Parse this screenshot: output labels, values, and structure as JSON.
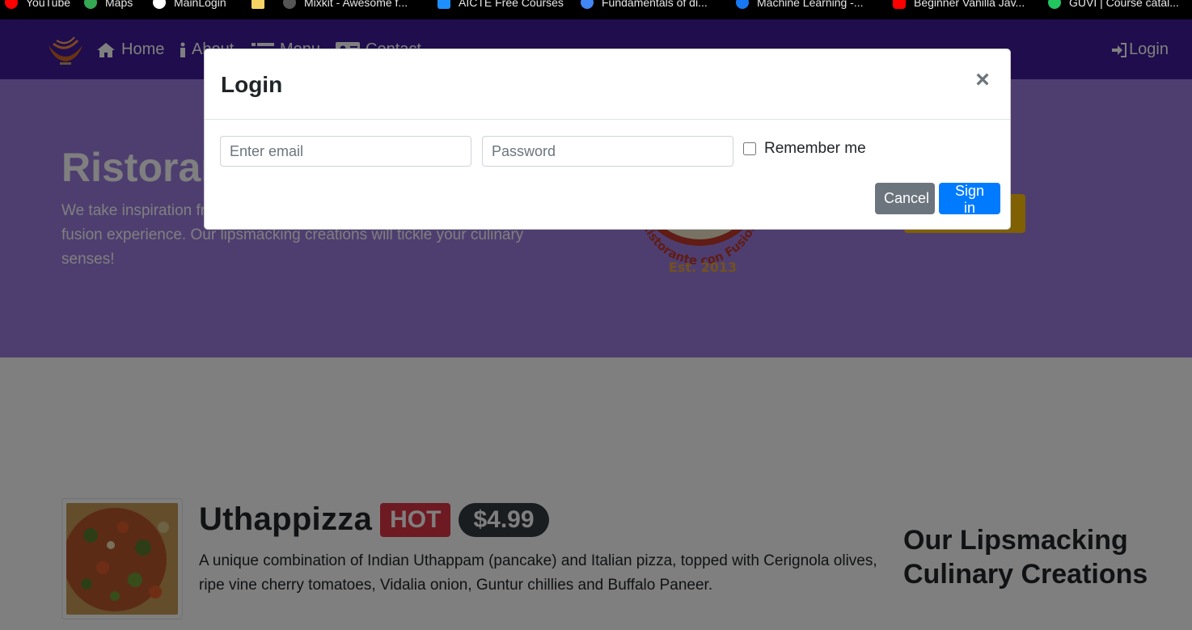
{
  "bookmarks": [
    {
      "label": "YouTube",
      "icon": "youtube-icon",
      "color": "#ff0000"
    },
    {
      "label": "Maps",
      "icon": "maps-icon",
      "color": "#34a853"
    },
    {
      "label": "MainLogin",
      "icon": "mainlogin-icon",
      "color": "#ffffff"
    },
    {
      "label": "",
      "icon": "folder-icon",
      "color": "#f6d365"
    },
    {
      "label": "Mixkit - Awesome f...",
      "icon": "mixkit-icon",
      "color": "#555555"
    },
    {
      "label": "AICTE Free Courses",
      "icon": "aicte-icon",
      "color": "#1f8fff"
    },
    {
      "label": "Fundamentals of di...",
      "icon": "google-icon",
      "color": "#4285f4"
    },
    {
      "label": "Machine Learning -...",
      "icon": "meta-icon",
      "color": "#1877f2"
    },
    {
      "label": "Beginner Vanilla Jav...",
      "icon": "youtube-icon",
      "color": "#ff0000"
    },
    {
      "label": "GUVI | Course catal...",
      "icon": "guvi-icon",
      "color": "#22c55e"
    }
  ],
  "navbar": {
    "items": [
      {
        "label": "Home",
        "icon": "home-icon"
      },
      {
        "label": "About",
        "icon": "info-icon"
      },
      {
        "label": "Menu",
        "icon": "list-icon"
      },
      {
        "label": "Contact",
        "icon": "address-card-icon"
      }
    ],
    "login_label": "Login"
  },
  "jumbotron": {
    "title": "Ristorante con Fusion",
    "text": "We take inspiration from the World's best cuisines, and create a unique fusion experience. Our lipsmacking creations will tickle your culinary senses!",
    "badge_ring_text": "Ristorante con Fusion",
    "badge_est": "Est. 2013"
  },
  "dish": {
    "name": "Uthappizza",
    "hot_label": "HOT",
    "price": "$4.99",
    "description": "A unique combination of Indian Uthappam (pancake) and Italian pizza, topped with Cerignola olives, ripe vine cherry tomatoes, Vidalia onion, Guntur chillies and Buffalo Paneer."
  },
  "side_heading": "Our Lipsmacking Culinary Creations",
  "modal": {
    "title": "Login",
    "close_symbol": "×",
    "email_placeholder": "Enter email",
    "password_placeholder": "Password",
    "remember_label": "Remember me",
    "cancel_label": "Cancel",
    "signin_label": "Sign in"
  },
  "colors": {
    "navbar": "#3f1b9a",
    "jumbotron": "#9d7de0",
    "primary": "#007bff",
    "secondary": "#6c757d",
    "danger": "#dc3545",
    "dark": "#343a40",
    "warning": "#ffc107"
  }
}
